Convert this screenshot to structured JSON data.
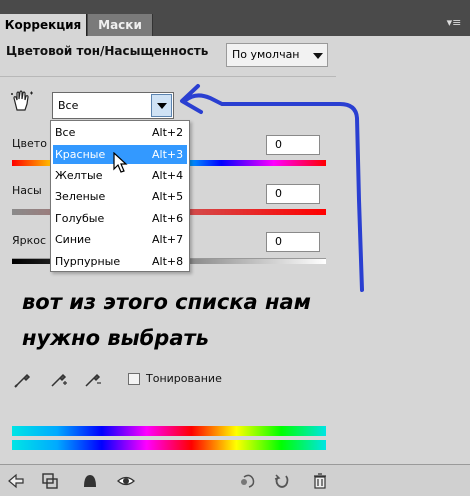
{
  "tabs": [
    {
      "label": "Коррекция",
      "active": true
    },
    {
      "label": "Маски",
      "active": false
    }
  ],
  "header": {
    "title": "Цветовой тон/Насыщенность",
    "preset_value": "По умолчан"
  },
  "channel_select": {
    "value": "Все"
  },
  "sliders": [
    {
      "label": "Цвето",
      "value": "0"
    },
    {
      "label": "Насы",
      "value": "0"
    },
    {
      "label": "Яркос",
      "value": "0"
    }
  ],
  "dropdown_items": [
    {
      "label": "Все",
      "shortcut": "Alt+2"
    },
    {
      "label": "Красные",
      "shortcut": "Alt+3",
      "selected": true
    },
    {
      "label": "Желтые",
      "shortcut": "Alt+4"
    },
    {
      "label": "Зеленые",
      "shortcut": "Alt+5"
    },
    {
      "label": "Голубые",
      "shortcut": "Alt+6"
    },
    {
      "label": "Синие",
      "shortcut": "Alt+7"
    },
    {
      "label": "Пурпурные",
      "shortcut": "Alt+8"
    }
  ],
  "annotation": {
    "line1": "вот из этого списка нам",
    "line2": "нужно выбрать",
    "color": "#2a3fd1"
  },
  "colorize": {
    "label": "Тонирование",
    "checked": false
  },
  "colors": {
    "selection": "#3399ff",
    "tabbar": "#4a4a4a"
  },
  "icons": {
    "hand": "hand-tool-icon",
    "droppers": [
      "eyedropper-icon",
      "eyedropper-plus-icon",
      "eyedropper-minus-icon"
    ],
    "bottom": [
      "back-arrow-icon",
      "clip-layer-icon",
      "mask-visibility-icon",
      "eye-icon",
      "previous-state-icon",
      "reset-icon",
      "trash-icon"
    ]
  }
}
